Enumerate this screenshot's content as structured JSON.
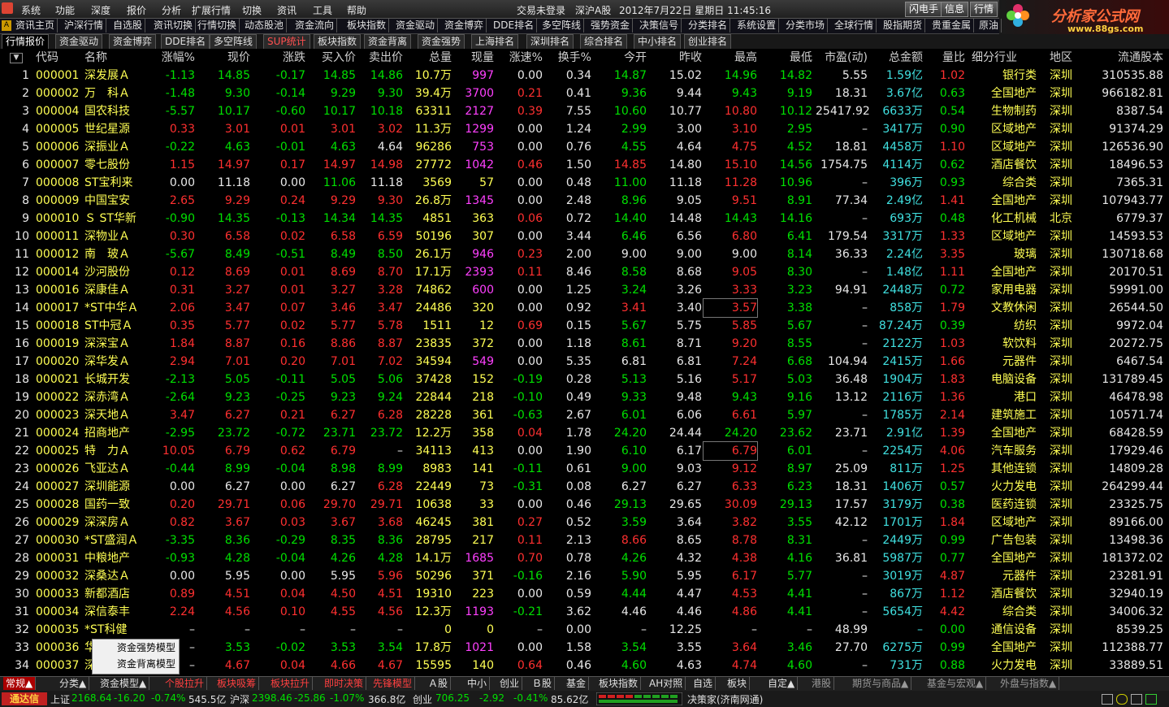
{
  "menu": {
    "items": [
      "系统",
      "功能",
      "深度",
      "报价",
      "分析",
      "扩展行情",
      "切换",
      "资讯",
      "工具",
      "帮助"
    ],
    "trade_status": "交易未登录",
    "market": "深沪A股",
    "datetime": "2012年7月22日  星期日  11:45:16",
    "buttons": [
      "闪电手",
      "信息",
      "行情"
    ]
  },
  "brand": {
    "name": "分析家公式网",
    "url": "www.88gs.com"
  },
  "nav1": [
    "资讯主页",
    "沪深行情",
    "自选股",
    "资讯切换",
    "行情切换",
    "动态股池",
    "资金流向",
    "板块指数",
    "资金驱动",
    "资金博弈",
    "DDE排名",
    "多空阵线",
    "强势资金",
    "决策信号",
    "分类排名",
    "系统设置",
    "分类市场",
    "全球行情",
    "股指期货",
    "贵重金属",
    "原油"
  ],
  "nav2": {
    "tabs": [
      "行情报价",
      "资金驱动",
      "资金博弈",
      "DDE排名",
      "多空阵线",
      "SUP统计",
      "板块指数",
      "资金背离",
      "资金强势",
      "上海排名",
      "深圳排名",
      "综合排名",
      "中小排名",
      "创业排名"
    ],
    "active": "行情报价",
    "highlight": "SUP统计"
  },
  "table": {
    "headers": [
      "",
      "代码",
      "名称",
      "涨幅%",
      "现价",
      "涨跌",
      "买入价",
      "卖出价",
      "总量",
      "现量",
      "涨速%",
      "换手%",
      "今开",
      "昨收",
      "最高",
      "最低",
      "市盈(动)",
      "总金额",
      "量比",
      "细分行业",
      "地区",
      "流通股本"
    ],
    "rows": [
      [
        "1",
        "000001",
        "深发展Ａ",
        "-1.13",
        "14.85",
        "-0.17",
        "14.85",
        "14.86",
        "10.7万",
        "997",
        "0.00",
        "0.34",
        "14.87",
        "15.02",
        "14.96",
        "14.82",
        "5.55",
        "1.59亿",
        "1.02",
        "银行类",
        "深圳",
        "310535.88"
      ],
      [
        "2",
        "000002",
        "万　科Ａ",
        "-1.48",
        "9.30",
        "-0.14",
        "9.29",
        "9.30",
        "39.4万",
        "3700",
        "0.21",
        "0.41",
        "9.36",
        "9.44",
        "9.43",
        "9.19",
        "18.31",
        "3.67亿",
        "0.63",
        "全国地产",
        "深圳",
        "966182.81"
      ],
      [
        "3",
        "000004",
        "国农科技",
        "-5.57",
        "10.17",
        "-0.60",
        "10.17",
        "10.18",
        "63311",
        "2127",
        "0.39",
        "7.55",
        "10.60",
        "10.77",
        "10.80",
        "10.12",
        "25417.92",
        "6633万",
        "0.54",
        "生物制药",
        "深圳",
        "8387.54"
      ],
      [
        "4",
        "000005",
        "世纪星源",
        "0.33",
        "3.01",
        "0.01",
        "3.01",
        "3.02",
        "11.3万",
        "1299",
        "0.00",
        "1.24",
        "2.99",
        "3.00",
        "3.10",
        "2.95",
        "–",
        "3417万",
        "0.90",
        "区域地产",
        "深圳",
        "91374.29"
      ],
      [
        "5",
        "000006",
        "深振业Ａ",
        "-0.22",
        "4.63",
        "-0.01",
        "4.63",
        "4.64",
        "96286",
        "753",
        "0.00",
        "0.76",
        "4.55",
        "4.64",
        "4.75",
        "4.52",
        "18.81",
        "4458万",
        "1.10",
        "区域地产",
        "深圳",
        "126536.90"
      ],
      [
        "6",
        "000007",
        "零七股份",
        "1.15",
        "14.97",
        "0.17",
        "14.97",
        "14.98",
        "27772",
        "1042",
        "0.46",
        "1.50",
        "14.85",
        "14.80",
        "15.10",
        "14.56",
        "1754.75",
        "4114万",
        "0.62",
        "酒店餐饮",
        "深圳",
        "18496.53"
      ],
      [
        "7",
        "000008",
        "ST宝利来",
        "0.00",
        "11.18",
        "0.00",
        "11.06",
        "11.18",
        "3569",
        "57",
        "0.00",
        "0.48",
        "11.00",
        "11.18",
        "11.28",
        "10.96",
        "–",
        "396万",
        "0.93",
        "综合类",
        "深圳",
        "7365.31"
      ],
      [
        "8",
        "000009",
        "中国宝安",
        "2.65",
        "9.29",
        "0.24",
        "9.29",
        "9.30",
        "26.8万",
        "1345",
        "0.00",
        "2.48",
        "8.96",
        "9.05",
        "9.51",
        "8.91",
        "77.34",
        "2.49亿",
        "1.41",
        "全国地产",
        "深圳",
        "107943.77"
      ],
      [
        "9",
        "000010",
        "Ｓ ST华新",
        "-0.90",
        "14.35",
        "-0.13",
        "14.34",
        "14.35",
        "4851",
        "363",
        "0.06",
        "0.72",
        "14.40",
        "14.48",
        "14.43",
        "14.16",
        "–",
        "693万",
        "0.48",
        "化工机械",
        "北京",
        "6779.37"
      ],
      [
        "10",
        "000011",
        "深物业Ａ",
        "0.30",
        "6.58",
        "0.02",
        "6.58",
        "6.59",
        "50196",
        "307",
        "0.00",
        "3.44",
        "6.46",
        "6.56",
        "6.80",
        "6.41",
        "179.54",
        "3317万",
        "1.33",
        "区域地产",
        "深圳",
        "14593.53"
      ],
      [
        "11",
        "000012",
        "南　玻Ａ",
        "-5.67",
        "8.49",
        "-0.51",
        "8.49",
        "8.50",
        "26.1万",
        "946",
        "0.23",
        "2.00",
        "9.00",
        "9.00",
        "9.00",
        "8.14",
        "36.33",
        "2.24亿",
        "3.35",
        "玻璃",
        "深圳",
        "130718.68"
      ],
      [
        "12",
        "000014",
        "沙河股份",
        "0.12",
        "8.69",
        "0.01",
        "8.69",
        "8.70",
        "17.1万",
        "2393",
        "0.11",
        "8.46",
        "8.58",
        "8.68",
        "9.05",
        "8.30",
        "–",
        "1.48亿",
        "1.11",
        "全国地产",
        "深圳",
        "20170.51"
      ],
      [
        "13",
        "000016",
        "深康佳Ａ",
        "0.31",
        "3.27",
        "0.01",
        "3.27",
        "3.28",
        "74862",
        "600",
        "0.00",
        "1.25",
        "3.24",
        "3.26",
        "3.33",
        "3.23",
        "94.91",
        "2448万",
        "0.72",
        "家用电器",
        "深圳",
        "59991.00"
      ],
      [
        "14",
        "000017",
        "*ST中华Ａ",
        "2.06",
        "3.47",
        "0.07",
        "3.46",
        "3.47",
        "24486",
        "320",
        "0.00",
        "0.92",
        "3.41",
        "3.40",
        "3.57",
        "3.38",
        "–",
        "858万",
        "1.79",
        "文教休闲",
        "深圳",
        "26544.50"
      ],
      [
        "15",
        "000018",
        "ST中冠Ａ",
        "0.35",
        "5.77",
        "0.02",
        "5.77",
        "5.78",
        "1511",
        "12",
        "0.69",
        "0.15",
        "5.67",
        "5.75",
        "5.85",
        "5.67",
        "–",
        "87.24万",
        "0.39",
        "纺织",
        "深圳",
        "9972.04"
      ],
      [
        "16",
        "000019",
        "深深宝Ａ",
        "1.84",
        "8.87",
        "0.16",
        "8.86",
        "8.87",
        "23835",
        "372",
        "0.00",
        "1.18",
        "8.61",
        "8.71",
        "9.20",
        "8.55",
        "–",
        "2122万",
        "1.03",
        "软饮料",
        "深圳",
        "20272.75"
      ],
      [
        "17",
        "000020",
        "深华发Ａ",
        "2.94",
        "7.01",
        "0.20",
        "7.01",
        "7.02",
        "34594",
        "549",
        "0.00",
        "5.35",
        "6.81",
        "6.81",
        "7.24",
        "6.68",
        "104.94",
        "2415万",
        "1.66",
        "元器件",
        "深圳",
        "6467.54"
      ],
      [
        "18",
        "000021",
        "长城开发",
        "-2.13",
        "5.05",
        "-0.11",
        "5.05",
        "5.06",
        "37428",
        "152",
        "-0.19",
        "0.28",
        "5.13",
        "5.16",
        "5.17",
        "5.03",
        "36.48",
        "1904万",
        "1.83",
        "电脑设备",
        "深圳",
        "131789.45"
      ],
      [
        "19",
        "000022",
        "深赤湾Ａ",
        "-2.64",
        "9.23",
        "-0.25",
        "9.23",
        "9.24",
        "22844",
        "218",
        "-0.10",
        "0.49",
        "9.33",
        "9.48",
        "9.43",
        "9.16",
        "13.12",
        "2116万",
        "1.36",
        "港口",
        "深圳",
        "46478.98"
      ],
      [
        "20",
        "000023",
        "深天地Ａ",
        "3.47",
        "6.27",
        "0.21",
        "6.27",
        "6.28",
        "28228",
        "361",
        "-0.63",
        "2.67",
        "6.01",
        "6.06",
        "6.61",
        "5.97",
        "–",
        "1785万",
        "2.14",
        "建筑施工",
        "深圳",
        "10571.74"
      ],
      [
        "21",
        "000024",
        "招商地产",
        "-2.95",
        "23.72",
        "-0.72",
        "23.71",
        "23.72",
        "12.2万",
        "358",
        "0.04",
        "1.78",
        "24.20",
        "24.44",
        "24.20",
        "23.62",
        "23.71",
        "2.91亿",
        "1.39",
        "全国地产",
        "深圳",
        "68428.59"
      ],
      [
        "22",
        "000025",
        "特　力Ａ",
        "10.05",
        "6.79",
        "0.62",
        "6.79",
        "–",
        "34113",
        "413",
        "0.00",
        "1.90",
        "6.10",
        "6.17",
        "6.79",
        "6.01",
        "–",
        "2254万",
        "4.06",
        "汽车服务",
        "深圳",
        "17929.46"
      ],
      [
        "23",
        "000026",
        "飞亚达Ａ",
        "-0.44",
        "8.99",
        "-0.04",
        "8.98",
        "8.99",
        "8983",
        "141",
        "-0.11",
        "0.61",
        "9.00",
        "9.03",
        "9.12",
        "8.97",
        "25.09",
        "811万",
        "1.25",
        "其他连锁",
        "深圳",
        "14809.28"
      ],
      [
        "24",
        "000027",
        "深圳能源",
        "0.00",
        "6.27",
        "0.00",
        "6.27",
        "6.28",
        "22449",
        "73",
        "-0.31",
        "0.08",
        "6.27",
        "6.27",
        "6.33",
        "6.23",
        "18.31",
        "1406万",
        "0.57",
        "火力发电",
        "深圳",
        "264299.44"
      ],
      [
        "25",
        "000028",
        "国药一致",
        "0.20",
        "29.71",
        "0.06",
        "29.70",
        "29.71",
        "10638",
        "33",
        "0.00",
        "0.46",
        "29.13",
        "29.65",
        "30.09",
        "29.13",
        "17.57",
        "3179万",
        "0.38",
        "医药连锁",
        "深圳",
        "23325.75"
      ],
      [
        "26",
        "000029",
        "深深房Ａ",
        "0.82",
        "3.67",
        "0.03",
        "3.67",
        "3.68",
        "46245",
        "381",
        "0.27",
        "0.52",
        "3.59",
        "3.64",
        "3.82",
        "3.55",
        "42.12",
        "1701万",
        "1.84",
        "区域地产",
        "深圳",
        "89166.00"
      ],
      [
        "27",
        "000030",
        "*ST盛润Ａ",
        "-3.35",
        "8.36",
        "-0.29",
        "8.35",
        "8.36",
        "28795",
        "217",
        "0.11",
        "2.13",
        "8.66",
        "8.65",
        "8.78",
        "8.31",
        "–",
        "2449万",
        "0.99",
        "广告包装",
        "深圳",
        "13498.36"
      ],
      [
        "28",
        "000031",
        "中粮地产",
        "-0.93",
        "4.28",
        "-0.04",
        "4.26",
        "4.28",
        "14.1万",
        "1685",
        "0.70",
        "0.78",
        "4.26",
        "4.32",
        "4.38",
        "4.16",
        "36.81",
        "5987万",
        "0.77",
        "全国地产",
        "深圳",
        "181372.02"
      ],
      [
        "29",
        "000032",
        "深桑达Ａ",
        "0.00",
        "5.95",
        "0.00",
        "5.95",
        "5.96",
        "50296",
        "371",
        "-0.16",
        "2.16",
        "5.90",
        "5.95",
        "6.17",
        "5.77",
        "–",
        "3019万",
        "4.87",
        "元器件",
        "深圳",
        "23281.91"
      ],
      [
        "30",
        "000033",
        "新都酒店",
        "0.89",
        "4.51",
        "0.04",
        "4.50",
        "4.51",
        "19310",
        "223",
        "0.00",
        "0.59",
        "4.44",
        "4.47",
        "4.53",
        "4.41",
        "–",
        "867万",
        "1.12",
        "酒店餐饮",
        "深圳",
        "32940.19"
      ],
      [
        "31",
        "000034",
        "深信泰丰",
        "2.24",
        "4.56",
        "0.10",
        "4.55",
        "4.56",
        "12.3万",
        "1193",
        "-0.21",
        "3.62",
        "4.46",
        "4.46",
        "4.86",
        "4.41",
        "–",
        "5654万",
        "4.42",
        "综合类",
        "深圳",
        "34006.32"
      ],
      [
        "32",
        "000035",
        "*ST科健",
        "–",
        "–",
        "–",
        "–",
        "–",
        "0",
        "0",
        "–",
        "0.00",
        "–",
        "12.25",
        "–",
        "–",
        "48.99",
        "–",
        "0.00",
        "通信设备",
        "深圳",
        "8539.25"
      ],
      [
        "33",
        "000036",
        "华联控股",
        "–",
        "3.53",
        "-0.02",
        "3.53",
        "3.54",
        "17.8万",
        "1021",
        "0.00",
        "1.58",
        "3.54",
        "3.55",
        "3.64",
        "3.46",
        "27.70",
        "6275万",
        "0.99",
        "全国地产",
        "深圳",
        "112388.77"
      ],
      [
        "34",
        "000037",
        "深南电Ａ",
        "–",
        "4.67",
        "0.04",
        "4.66",
        "4.67",
        "15595",
        "140",
        "0.64",
        "0.46",
        "4.60",
        "4.63",
        "4.74",
        "4.60",
        "–",
        "731万",
        "0.88",
        "火力发电",
        "深圳",
        "33889.51"
      ]
    ]
  },
  "popup": {
    "items": [
      "资金强势模型",
      "资金背离模型"
    ]
  },
  "bottom_tabs": [
    "常规▲",
    "分类▲",
    "资金模型▲",
    "个股拉升",
    "板块吸筹",
    "板块拉升",
    "即时决策",
    "先锋模型",
    "Ａ股",
    "中小",
    "创业",
    "Ｂ股",
    "基金",
    "板块指数",
    "AH对照",
    "自选",
    "板块",
    "自定▲",
    "港股",
    "期货与商品▲",
    "基金与宏观▲",
    "外盘与指数▲"
  ],
  "status": {
    "logo": "通达信",
    "sh_label": "上证",
    "sh_price": "2168.64",
    "sh_change": "-16.20",
    "sh_pct": "-0.74%",
    "sh_amount": "545.5亿",
    "hs_label": "沪深",
    "hs_price": "2398.46",
    "hs_change": "-25.86",
    "hs_pct": "-1.07%",
    "hs_amount": "366.8亿",
    "cy_label": "创业",
    "cy_price": "706.25",
    "cy_change": "-2.92",
    "cy_pct": "-0.41%",
    "cy_amount": "85.62亿",
    "server": "决策家(济南网通)"
  }
}
